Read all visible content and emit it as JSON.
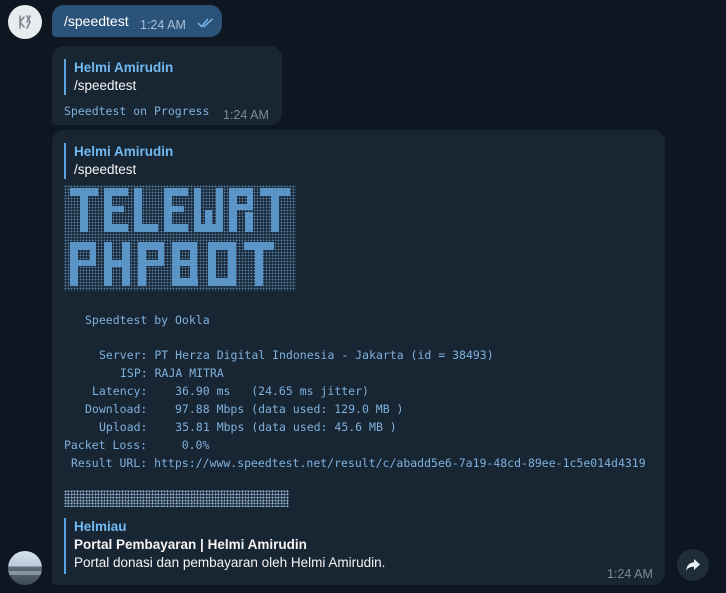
{
  "messages": [
    {
      "text": "/speedtest",
      "time": "1:24 AM"
    },
    {
      "reply_name": "Helmi Amirudin",
      "reply_text": "/speedtest",
      "status": "Speedtest on Progress",
      "time": "1:24 AM"
    },
    {
      "reply_name": "Helmi Amirudin",
      "reply_text": "/speedtest",
      "logo_alt": "TELEWRT PHPBOT",
      "provider_line": "Speedtest by Ookla",
      "server_line": "Server: PT Herza Digital Indonesia - Jakarta (id = 38493)",
      "isp_line": "ISP: RAJA MITRA",
      "latency_line": "Latency:    36.90 ms   (24.65 ms jitter)",
      "download_line": "Download:    97.88 Mbps (data used: 129.0 MB )",
      "upload_line": "Upload:    35.81 Mbps (data used: 45.6 MB )",
      "packet_loss_line": "Packet Loss:     0.0%",
      "result_line": "Result URL: https://www.speedtest.net/result/c/abadd5e6-7a19-48cd-89ee-1c5e014d4319",
      "preview_site": "Helmiau",
      "preview_title": "Portal Pembayaran | Helmi Amirudin",
      "preview_desc": "Portal donasi dan pembayaran oleh Helmi Amirudin.",
      "time": "1:24 AM"
    }
  ],
  "icons": {
    "top_avatar": "bot-logo-icon",
    "read_checks": "double-check-icon",
    "forward": "forward-arrow-icon"
  },
  "colors": {
    "background": "#0e1621",
    "incoming_bubble": "#182533",
    "outgoing_bubble": "#2b5278",
    "accent": "#71baf2",
    "mono_text": "#7fb1dd"
  }
}
